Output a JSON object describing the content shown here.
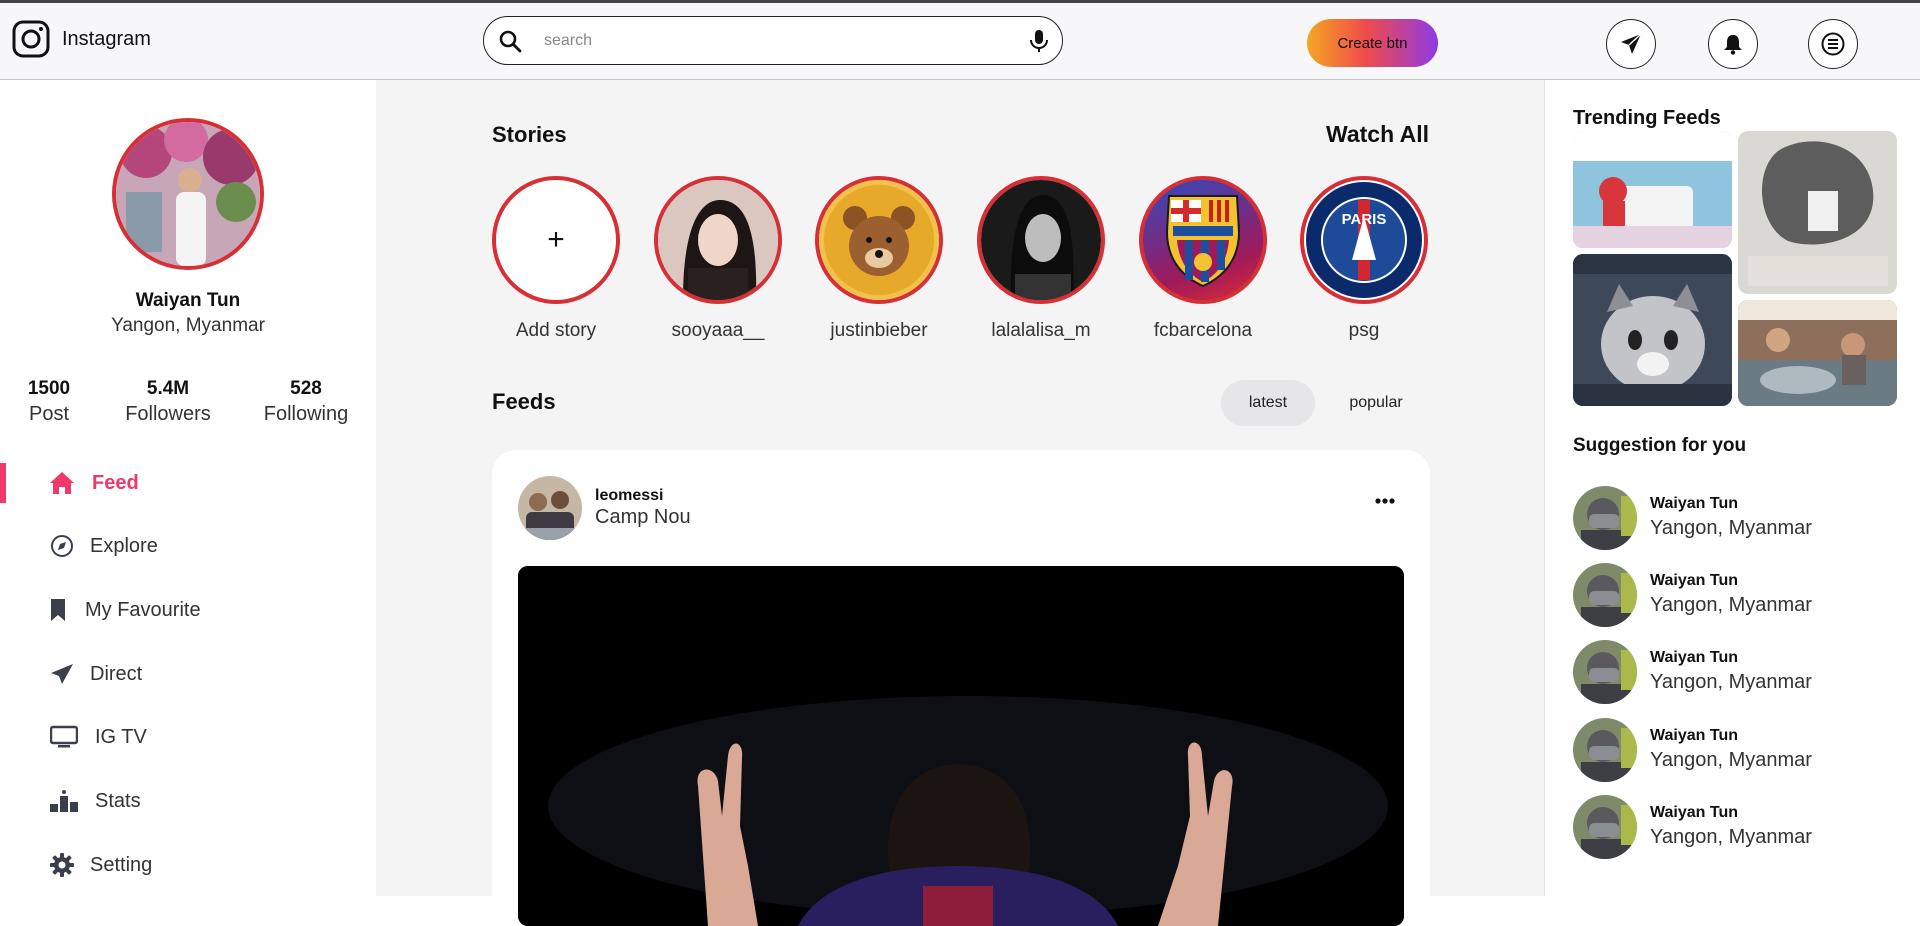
{
  "header": {
    "brand": "Instagram",
    "search_placeholder": "search",
    "search_value": "",
    "create_label": "Create btn",
    "icons": [
      "send-icon",
      "bell-icon",
      "menu-icon"
    ]
  },
  "profile": {
    "name": "Waiyan Tun",
    "location": "Yangon, Myanmar",
    "stats": [
      {
        "value": "1500",
        "label": "Post"
      },
      {
        "value": "5.4M",
        "label": "Followers"
      },
      {
        "value": "528",
        "label": "Following"
      }
    ]
  },
  "nav": [
    {
      "label": "Feed",
      "icon": "home-icon",
      "active": true
    },
    {
      "label": "Explore",
      "icon": "compass-icon",
      "active": false
    },
    {
      "label": "My Favourite",
      "icon": "bookmark-icon",
      "active": false
    },
    {
      "label": "Direct",
      "icon": "send-icon",
      "active": false
    },
    {
      "label": "IG TV",
      "icon": "tv-icon",
      "active": false
    },
    {
      "label": "Stats",
      "icon": "stats-icon",
      "active": false
    },
    {
      "label": "Setting",
      "icon": "gear-icon",
      "active": false
    }
  ],
  "stories": {
    "title": "Stories",
    "watch_all": "Watch All",
    "items": [
      {
        "name": "Add story",
        "add": true,
        "add_symbol": "+"
      },
      {
        "name": "sooyaaa__"
      },
      {
        "name": "justinbieber"
      },
      {
        "name": "lalalalisa_m"
      },
      {
        "name": "fcbarcelona"
      },
      {
        "name": "psg"
      }
    ]
  },
  "feeds": {
    "title": "Feeds",
    "tabs": [
      {
        "label": "latest",
        "selected": true
      },
      {
        "label": "popular",
        "selected": false
      }
    ],
    "post": {
      "user": "leomessi",
      "location": "Camp Nou"
    }
  },
  "trending": {
    "title": "Trending Feeds"
  },
  "suggestions": {
    "title": "Suggestion for you",
    "items": [
      {
        "name": "Waiyan Tun",
        "location": "Yangon, Myanmar"
      },
      {
        "name": "Waiyan Tun",
        "location": "Yangon, Myanmar"
      },
      {
        "name": "Waiyan Tun",
        "location": "Yangon, Myanmar"
      },
      {
        "name": "Waiyan Tun",
        "location": "Yangon, Myanmar"
      },
      {
        "name": "Waiyan Tun",
        "location": "Yangon, Myanmar"
      }
    ]
  },
  "colors": {
    "accent": "#f0386b",
    "story_ring": "#d62f36",
    "create_gradient": [
      "#f5a623",
      "#f04b4b",
      "#8e3ae6"
    ]
  }
}
